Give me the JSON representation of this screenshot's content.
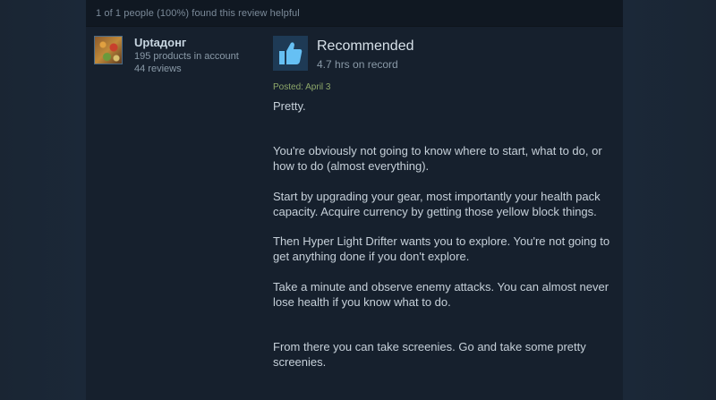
{
  "helpful": {
    "text": "1 of 1 people (100%) found this review helpful"
  },
  "author": {
    "name": "Uptaдонг",
    "products": "195 products in account",
    "reviews": "44 reviews",
    "avatar_icon": "game-art-avatar"
  },
  "vote": {
    "icon": "thumbs-up-icon",
    "title": "Recommended",
    "hours": "4.7 hrs on record"
  },
  "posted": "Posted: April 3",
  "review": {
    "paragraphs": [
      "Pretty.",
      "You're obviously not going to know where to start, what to do, or how to do (almost everything).",
      "Start by upgrading your gear, most importantly your health pack capacity. Acquire currency by getting those yellow block things.",
      "Then Hyper Light Drifter wants you to explore. You're not going to get anything done if you don't explore.",
      "Take a minute and observe enemy attacks. You can almost never lose health if you know what to do.",
      "From there you can take screenies. Go and take some pretty screenies."
    ]
  },
  "colors": {
    "background": "#1b2838",
    "posted_date": "#8ea86a",
    "thumb_accent": "#66c0f4"
  }
}
